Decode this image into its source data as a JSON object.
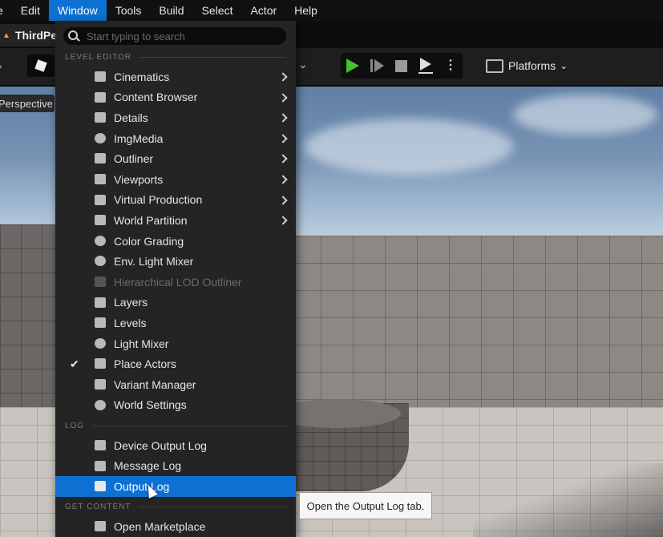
{
  "menubar": {
    "items": [
      {
        "label": "e"
      },
      {
        "label": "Edit"
      },
      {
        "label": "Window"
      },
      {
        "label": "Tools"
      },
      {
        "label": "Build"
      },
      {
        "label": "Select"
      },
      {
        "label": "Actor"
      },
      {
        "label": "Help"
      }
    ]
  },
  "tab": {
    "title": "ThirdPe"
  },
  "toolbar": {
    "platforms_label": "Platforms"
  },
  "viewport": {
    "mode_label": "Perspective"
  },
  "menu": {
    "search_placeholder": "Start typing to search",
    "sections": {
      "level_editor": "LEVEL EDITOR",
      "log": "LOG",
      "get_content": "GET CONTENT"
    },
    "level_editor_items": [
      {
        "label": "Cinematics",
        "submenu": true
      },
      {
        "label": "Content Browser",
        "submenu": true
      },
      {
        "label": "Details",
        "submenu": true
      },
      {
        "label": "ImgMedia",
        "submenu": true
      },
      {
        "label": "Outliner",
        "submenu": true
      },
      {
        "label": "Viewports",
        "submenu": true
      },
      {
        "label": "Virtual Production",
        "submenu": true
      },
      {
        "label": "World Partition",
        "submenu": true
      },
      {
        "label": "Color Grading"
      },
      {
        "label": "Env. Light Mixer"
      },
      {
        "label": "Hierarchical LOD Outliner",
        "disabled": true
      },
      {
        "label": "Layers"
      },
      {
        "label": "Levels"
      },
      {
        "label": "Light Mixer"
      },
      {
        "label": "Place Actors",
        "checked": true
      },
      {
        "label": "Variant Manager"
      },
      {
        "label": "World Settings"
      }
    ],
    "log_items": [
      {
        "label": "Device Output Log"
      },
      {
        "label": "Message Log"
      },
      {
        "label": "Output Log",
        "highlighted": true
      }
    ],
    "get_content_items": [
      {
        "label": "Open Marketplace"
      }
    ]
  },
  "tooltip": {
    "text": "Open the Output Log tab."
  },
  "colors": {
    "accent": "#0e70d2",
    "play": "#44c030",
    "menu_bg": "#242424"
  }
}
